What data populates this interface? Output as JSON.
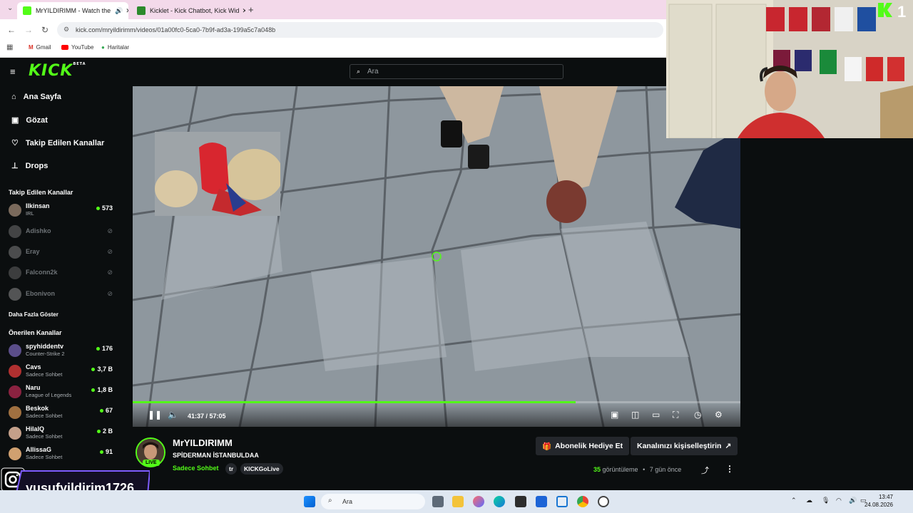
{
  "browser": {
    "tabs": [
      {
        "label": "MrYILDIRIMM - Watch the",
        "active": true
      },
      {
        "label": "Kicklet - Kick Chatbot, Kick Wid",
        "active": false
      }
    ],
    "new_tab_icon": "plus-icon",
    "url": "kick.com/mryildirimm/videos/01a00fc0-5ca0-7b9f-ad3a-199a5c7a048b",
    "bookmarks": [
      "Gmail",
      "YouTube",
      "Haritalar"
    ]
  },
  "header": {
    "logo": "KICK",
    "logo_badge": "BETA",
    "search_placeholder": "Ara"
  },
  "sidebar": {
    "nav": [
      {
        "label": "Ana Sayfa",
        "icon": "home-icon"
      },
      {
        "label": "Gözat",
        "icon": "browse-icon"
      },
      {
        "label": "Takip Edilen Kanallar",
        "icon": "heart-icon"
      },
      {
        "label": "Drops",
        "icon": "drops-icon"
      }
    ],
    "following_title": "Takip Edilen Kanallar",
    "following": [
      {
        "name": "Ilkinsan",
        "category": "IRL",
        "viewers": "573",
        "live": true
      },
      {
        "name": "Adishko",
        "live": false
      },
      {
        "name": "Eray",
        "live": false
      },
      {
        "name": "Falconn2k",
        "live": false
      },
      {
        "name": "Ebonivon",
        "live": false
      }
    ],
    "show_more": "Daha Fazla Göster",
    "recommended_title": "Önerilen Kanallar",
    "recommended": [
      {
        "name": "spyhiddentv",
        "category": "Counter-Strike 2",
        "viewers": "176"
      },
      {
        "name": "Cavs",
        "category": "Sadece Sohbet",
        "viewers": "3,7 B"
      },
      {
        "name": "Naru",
        "category": "League of Legends",
        "viewers": "1,8 B"
      },
      {
        "name": "Beskok",
        "category": "Sadece Sohbet",
        "viewers": "67"
      },
      {
        "name": "HilalQ",
        "category": "Sadece Sohbet",
        "viewers": "2 B"
      },
      {
        "name": "AllissaG",
        "category": "Sadece Sohbet",
        "viewers": "91"
      }
    ]
  },
  "player": {
    "time_current": "41:37",
    "time_total": "57:05",
    "time_display": "41:37 / 57:05",
    "progress": 0.729
  },
  "stream": {
    "streamer": "MrYILDIRIMM",
    "live_badge": "LIVE",
    "title": "SPİDERMAN İSTANBULDAA",
    "category": "Sadece Sohbet",
    "tags": [
      "tr",
      "KICKGoLive"
    ],
    "gift_button": "Abonelik Hediye Et",
    "customize_button": "Kanalınızı kişiselleştirin",
    "views_count": "35",
    "views_label": "görüntüleme",
    "age": "7 gün önce"
  },
  "overlay": {
    "kick_number": "1",
    "instagram_handle": "yusufyildirim1726"
  },
  "taskbar": {
    "search_placeholder": "Ara",
    "time": "13:47",
    "date": "24.08.2026"
  },
  "colors": {
    "kick_green": "#53fc18",
    "background": "#0b0e0f",
    "button": "#24272c"
  }
}
